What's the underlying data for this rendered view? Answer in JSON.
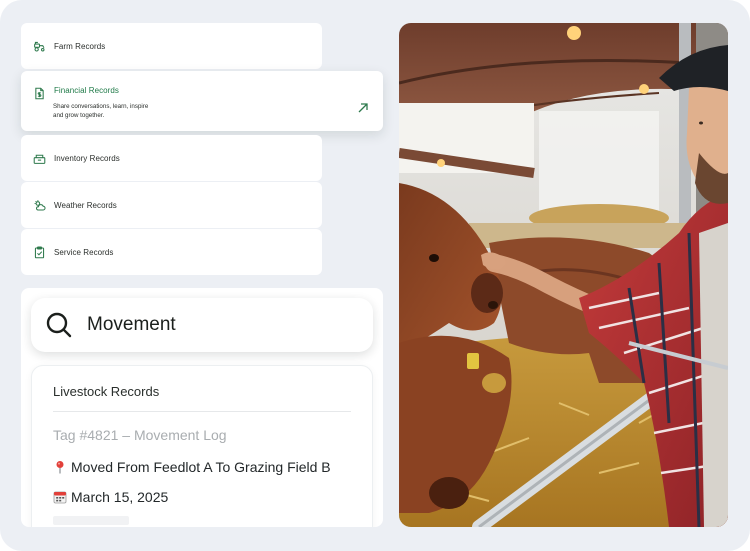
{
  "menu": {
    "items": [
      {
        "label": "Farm Records",
        "icon": "tractor-icon"
      },
      {
        "label": "Financial Records",
        "icon": "dollar-document-icon",
        "description_line1": "Share conversations, learn, inspire",
        "description_line2": "and grow together."
      },
      {
        "label": "Inventory Records",
        "icon": "boxes-icon"
      },
      {
        "label": "Weather Records",
        "icon": "cloud-sun-icon"
      },
      {
        "label": "Service Records",
        "icon": "clipboard-check-icon"
      }
    ]
  },
  "search": {
    "value": "Movement"
  },
  "record": {
    "title": "Livestock Records",
    "tag_line": "Tag #4821 – Movement Log",
    "movement": "Moved From Feedlot A To Grazing Field B",
    "date": "March 15, 2025"
  },
  "colors": {
    "accent": "#1f7a48",
    "background": "#eceff4"
  }
}
